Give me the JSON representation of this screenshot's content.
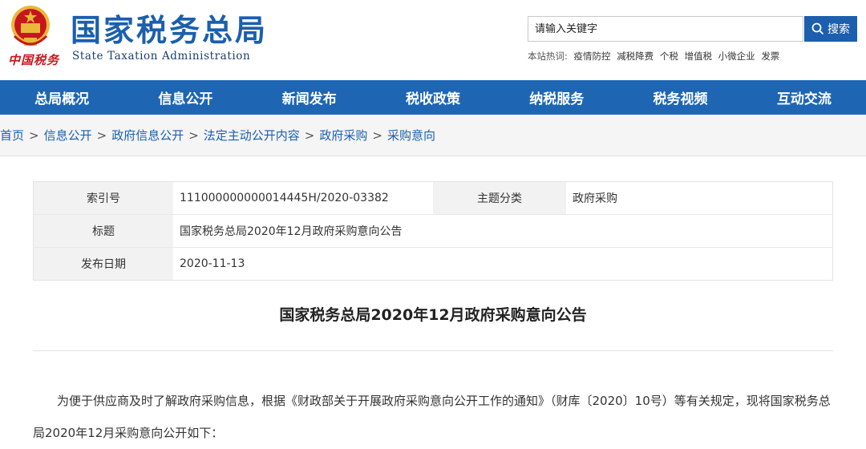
{
  "header": {
    "logo_cn": "国家税务总局",
    "logo_en": "State Taxation Administration",
    "logo_sub": "中国税务",
    "search_placeholder": "请输入关键字",
    "search_button": "搜索",
    "hot_label": "本站热词:",
    "hot_words": [
      "疫情防控",
      "减税降费",
      "个税",
      "增值税",
      "小微企业",
      "发票"
    ]
  },
  "nav": {
    "items": [
      "总局概况",
      "信息公开",
      "新闻发布",
      "税收政策",
      "纳税服务",
      "税务视频",
      "互动交流"
    ]
  },
  "breadcrumb": {
    "items": [
      "首页",
      "信息公开",
      "政府信息公开",
      "法定主动公开内容",
      "政府采购",
      "采购意向"
    ],
    "separator": ">"
  },
  "info": {
    "index_label": "索引号",
    "index_value": "111000000000014445H/2020-03382",
    "category_label": "主题分类",
    "category_value": "政府采购",
    "title_label": "标题",
    "title_value": "国家税务总局2020年12月政府采购意向公告",
    "date_label": "发布日期",
    "date_value": "2020-11-13"
  },
  "article": {
    "title": "国家税务总局2020年12月政府采购意向公告",
    "paragraph": "为便于供应商及时了解政府采购信息，根据《财政部关于开展政府采购意向公开工作的通知》（财库〔2020〕10号）等有关规定，现将国家税务总局2020年12月采购意向公开如下："
  },
  "colors": {
    "brand_blue": "#1b5fae",
    "nav_blue": "#1e66b4",
    "emblem_red": "#c8161d",
    "emblem_gold": "#e8b93a"
  }
}
